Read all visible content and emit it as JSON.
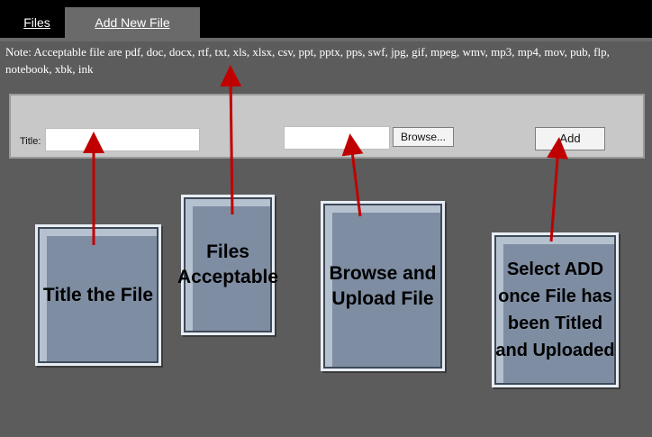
{
  "tabs": {
    "files": "Files",
    "add_new_file": "Add New File"
  },
  "note": "Note: Acceptable file are pdf, doc, docx, rtf, txt, xls, xlsx, csv, ppt, pptx, pps, swf, jpg, gif, mpeg, wmv, mp3, mp4, mov, pub, flp, notebook, xbk, ink",
  "form": {
    "title_label": "Title:",
    "title_value": "",
    "file_value": "",
    "browse_label": "Browse...",
    "add_label": "Add"
  },
  "callouts": {
    "title": "Title the File",
    "files": "Files Acceptable",
    "browse": "Browse and Upload File",
    "add": "Select ADD once File has been Titled and Uploaded"
  },
  "colors": {
    "background": "#5c5c5c",
    "tab_bar": "#000000",
    "form_panel": "#c8c8c8",
    "callout": "#7e8da2",
    "arrow": "#c00000"
  }
}
